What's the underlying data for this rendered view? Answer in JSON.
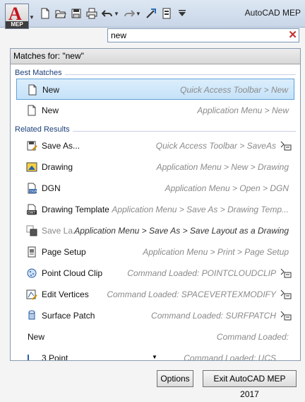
{
  "app": {
    "title": "AutoCAD MEP",
    "logo_letter": "A",
    "logo_badge": "MEP"
  },
  "search": {
    "value": "new"
  },
  "panel": {
    "header": "Matches for: \"new\""
  },
  "sections": {
    "best": "Best Matches",
    "related": "Related Results"
  },
  "best_matches": [
    {
      "label": "New",
      "path": "Quick Access Toolbar > New",
      "icon": "new-file-icon",
      "selected": true
    },
    {
      "label": "New",
      "path": "Application Menu > New",
      "icon": "new-file-icon"
    }
  ],
  "related": [
    {
      "label": "Save As...",
      "path": "Quick Access Toolbar > SaveAs",
      "icon": "save-as-icon"
    },
    {
      "label": "Drawing",
      "path": "Application Menu > New > Drawing",
      "icon": "drawing-icon"
    },
    {
      "label": "DGN",
      "path": "Application Menu > Open > DGN",
      "icon": "dgn-icon"
    },
    {
      "label": "Drawing Template",
      "path": "Application Menu > Save As > Drawing Temp...",
      "icon": "drawing-template-icon"
    },
    {
      "label": "Save La...",
      "path": "Application Menu > Save As > Save Layout as a Drawing",
      "icon": "save-layout-icon"
    },
    {
      "label": "Page Setup",
      "path": "Application Menu > Print > Page Setup",
      "icon": "page-setup-icon"
    },
    {
      "label": "Point Cloud Clip",
      "path": "Command Loaded: POINTCLOUDCLIP",
      "icon": "point-cloud-clip-icon"
    },
    {
      "label": "Edit Vertices",
      "path": "Command Loaded: SPACEVERTEXMODIFY",
      "icon": "edit-vertices-icon"
    },
    {
      "label": "Surface Patch",
      "path": "Command Loaded: SURFPATCH",
      "icon": "surface-patch-icon"
    },
    {
      "label": "New",
      "path": "Command Loaded:",
      "icon": "none"
    },
    {
      "label": "3 Point",
      "path": "Command Loaded: UCS",
      "icon": "ucs-3point-icon"
    }
  ],
  "buttons": {
    "options": "Options",
    "exit": "Exit AutoCAD MEP 2017"
  },
  "colors": {
    "accent": "#5fa0d8",
    "logo_red": "#c3141d",
    "clear_red": "#c0302a"
  }
}
